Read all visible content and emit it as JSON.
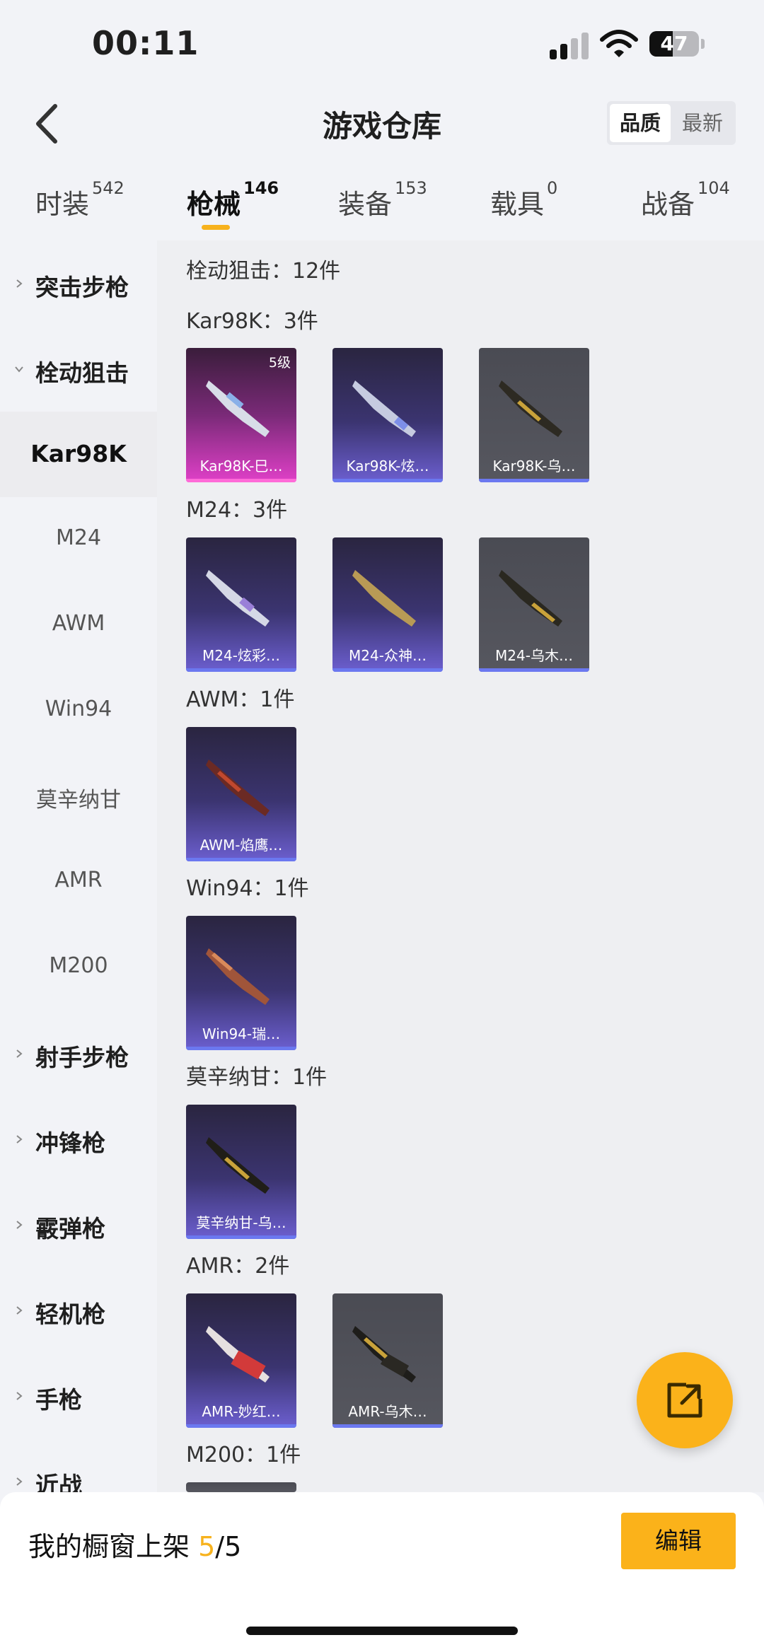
{
  "status": {
    "time": "00:11",
    "battery": "47",
    "battery_level": 0.47
  },
  "header": {
    "title": "游戏仓库",
    "sort": [
      "品质",
      "最新"
    ],
    "back_icon": "chevron-left-icon"
  },
  "tabs": [
    {
      "label": "时装",
      "count": "542"
    },
    {
      "label": "枪械",
      "count": "146"
    },
    {
      "label": "装备",
      "count": "153"
    },
    {
      "label": "载具",
      "count": "0"
    },
    {
      "label": "战备",
      "count": "104"
    }
  ],
  "sidebar": {
    "items": [
      {
        "label": "突击步枪"
      },
      {
        "label": "栓动狙击"
      },
      {
        "label": "Kar98K"
      },
      {
        "label": "M24"
      },
      {
        "label": "AWM"
      },
      {
        "label": "Win94"
      },
      {
        "label": "莫辛纳甘"
      },
      {
        "label": "AMR"
      },
      {
        "label": "M200"
      },
      {
        "label": "射手步枪"
      },
      {
        "label": "冲锋枪"
      },
      {
        "label": "霰弹枪"
      },
      {
        "label": "轻机枪"
      },
      {
        "label": "手枪"
      },
      {
        "label": "近战"
      }
    ]
  },
  "content": {
    "summary": "栓动狙击：12件",
    "sections": [
      {
        "heading": "Kar98K：3件",
        "cards": [
          {
            "name": "Kar98K-巳…",
            "level": "5级",
            "rarity": "pink"
          },
          {
            "name": "Kar98K-炫…",
            "rarity": "purple"
          },
          {
            "name": "Kar98K-乌…",
            "rarity": "gray"
          }
        ]
      },
      {
        "heading": "M24：3件",
        "cards": [
          {
            "name": "M24-炫彩…",
            "rarity": "purple"
          },
          {
            "name": "M24-众神…",
            "rarity": "purple"
          },
          {
            "name": "M24-乌木…",
            "rarity": "gray"
          }
        ]
      },
      {
        "heading": "AWM：1件",
        "cards": [
          {
            "name": "AWM-焰鹰…",
            "rarity": "purple"
          }
        ]
      },
      {
        "heading": "Win94：1件",
        "cards": [
          {
            "name": "Win94-瑞…",
            "rarity": "purple"
          }
        ]
      },
      {
        "heading": "莫辛纳甘：1件",
        "cards": [
          {
            "name": "莫辛纳甘-乌…",
            "rarity": "purple"
          }
        ]
      },
      {
        "heading": "AMR：2件",
        "cards": [
          {
            "name": "AMR-妙红…",
            "rarity": "purple"
          },
          {
            "name": "AMR-乌木…",
            "rarity": "gray"
          }
        ]
      },
      {
        "heading": "M200：1件",
        "cards": []
      }
    ]
  },
  "bottom": {
    "label": "我的橱窗上架 ",
    "current": "5",
    "total": "/5",
    "edit": "编辑"
  },
  "colors": {
    "accent": "#f7b21d",
    "purple_card": "#3b3470",
    "pink_card": "#e040c8",
    "gray_card": "#56575f"
  }
}
